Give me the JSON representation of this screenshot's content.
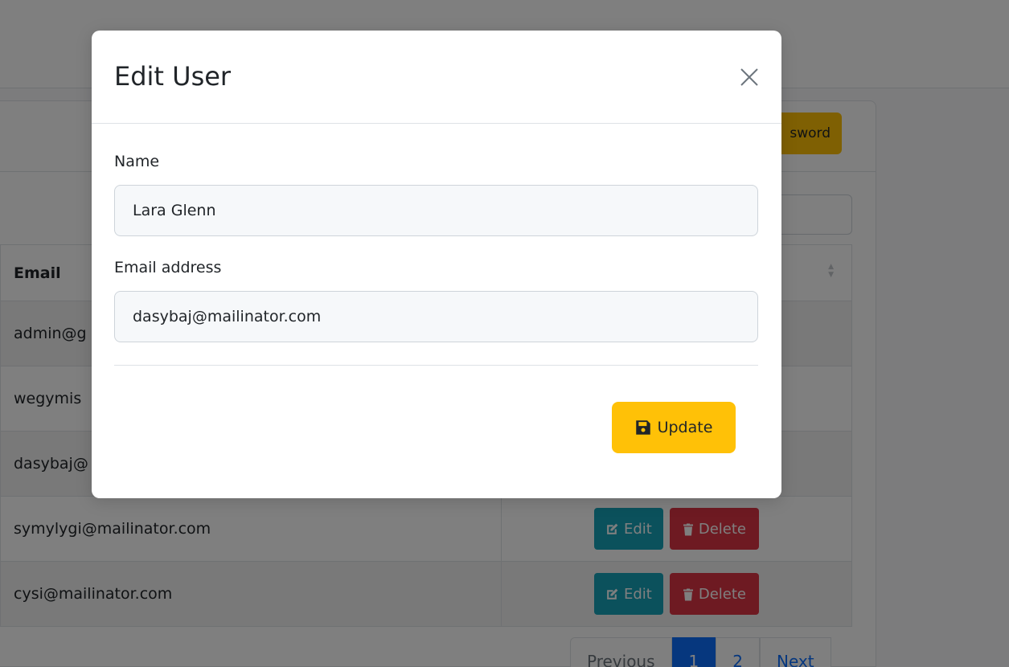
{
  "background": {
    "change_password_label": "sword",
    "table": {
      "email_header": "Email",
      "rows": [
        {
          "email": "admin@g",
          "striped": true
        },
        {
          "email": "wegymis",
          "striped": false
        },
        {
          "email": "dasybaj@",
          "striped": true
        },
        {
          "email": "symylygi@mailinator.com",
          "striped": false
        },
        {
          "email": "cysi@mailinator.com",
          "striped": true
        }
      ],
      "edit_label": "Edit",
      "delete_label": "Delete"
    },
    "pagination": {
      "previous": "Previous",
      "page1": "1",
      "page2": "2",
      "next": "Next"
    }
  },
  "modal": {
    "title": "Edit User",
    "name_label": "Name",
    "name_value": "Lara Glenn",
    "email_label": "Email address",
    "email_value": "dasybaj@mailinator.com",
    "update_label": "Update"
  },
  "colors": {
    "warning": "#ffc107",
    "info": "#17a2b8",
    "danger": "#dc3545",
    "primary": "#0d6efd"
  }
}
